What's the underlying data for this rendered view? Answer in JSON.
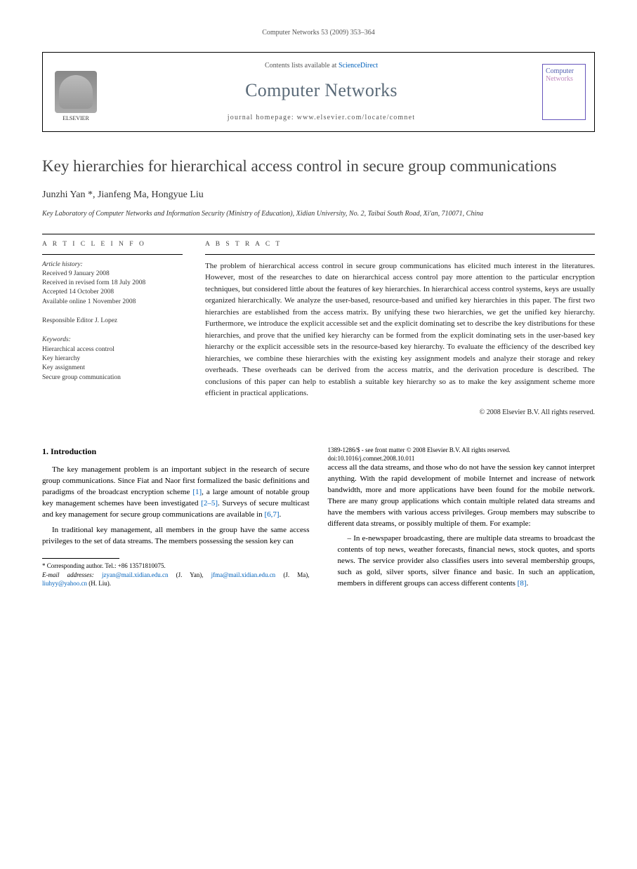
{
  "header": {
    "running": "Computer Networks 53 (2009) 353–364"
  },
  "journal_box": {
    "elsevier": "ELSEVIER",
    "contents_prefix": "Contents lists available at ",
    "contents_link": "ScienceDirect",
    "journal_name": "Computer Networks",
    "homepage_label": "journal homepage: www.elsevier.com/locate/comnet",
    "cover_line1": "Computer",
    "cover_line2": "Networks"
  },
  "article": {
    "title": "Key hierarchies for hierarchical access control in secure group communications",
    "authors": "Junzhi Yan *, Jianfeng Ma, Hongyue Liu",
    "affiliation": "Key Laboratory of Computer Networks and Information Security (Ministry of Education), Xidian University, No. 2, Taibai South Road, Xi'an, 710071, China"
  },
  "article_info": {
    "heading": "A R T I C L E   I N F O",
    "history_label": "Article history:",
    "received": "Received 9 January 2008",
    "revised": "Received in revised form 18 July 2008",
    "accepted": "Accepted 14 October 2008",
    "online": "Available online 1 November 2008",
    "editor": "Responsible Editor J. Lopez",
    "keywords_label": "Keywords:",
    "kw1": "Hierarchical access control",
    "kw2": "Key hierarchy",
    "kw3": "Key assignment",
    "kw4": "Secure group communication"
  },
  "abstract": {
    "heading": "A B S T R A C T",
    "text": "The problem of hierarchical access control in secure group communications has elicited much interest in the literatures. However, most of the researches to date on hierarchical access control pay more attention to the particular encryption techniques, but considered little about the features of key hierarchies. In hierarchical access control systems, keys are usually organized hierarchically. We analyze the user-based, resource-based and unified key hierarchies in this paper. The first two hierarchies are established from the access matrix. By unifying these two hierarchies, we get the unified key hierarchy. Furthermore, we introduce the explicit accessible set and the explicit dominating set to describe the key distributions for these hierarchies, and prove that the unified key hierarchy can be formed from the explicit dominating sets in the user-based key hierarchy or the explicit accessible sets in the resource-based key hierarchy. To evaluate the efficiency of the described key hierarchies, we combine these hierarchies with the existing key assignment models and analyze their storage and rekey overheads. These overheads can be derived from the access matrix, and the derivation procedure is described. The conclusions of this paper can help to establish a suitable key hierarchy so as to make the key assignment scheme more efficient in practical applications.",
    "copyright": "© 2008 Elsevier B.V. All rights reserved."
  },
  "body": {
    "section1": "1. Introduction",
    "p1a": "The key management problem is an important subject in the research of secure group communications. Since Fiat and Naor first formalized the basic definitions and paradigms of the broadcast encryption scheme ",
    "ref1": "[1]",
    "p1b": ", a large amount of notable group key management schemes have been investigated ",
    "ref2": "[2–5]",
    "p1c": ". Surveys of secure multicast and key management for secure group communications are available in ",
    "ref3": "[6,7]",
    "p1d": ".",
    "p2": "In traditional key management, all members in the group have the same access privileges to the set of data streams. The members possessing the session key can",
    "p3": "access all the data streams, and those who do not have the session key cannot interpret anything. With the rapid development of mobile Internet and increase of network bandwidth, more and more applications have been found for the mobile network. There are many group applications which contain multiple related data streams and have the members with various access privileges. Group members may subscribe to different data streams, or possibly multiple of them. For example:",
    "bullet1a": "– In e-newspaper broadcasting, there are multiple data streams to broadcast the contents of top news, weather forecasts, financial news, stock quotes, and sports news. The service provider also classifies users into several membership groups, such as gold, silver sports, silver finance and basic. In such an application, members in different groups can access different contents ",
    "ref4": "[8]",
    "bullet1b": "."
  },
  "footnotes": {
    "corr": "* Corresponding author. Tel.: +86 13571810075.",
    "emails_label": "E-mail addresses: ",
    "e1": "jzyan@mail.xidian.edu.cn",
    "e1n": " (J. Yan), ",
    "e2": "jfma@mail.xidian.edu.cn",
    "e2n": " (J. Ma), ",
    "e3": "liuhyy@yahoo.cn",
    "e3n": " (H. Liu)."
  },
  "doi": {
    "line1": "1389-1286/$ - see front matter © 2008 Elsevier B.V. All rights reserved.",
    "line2": "doi:10.1016/j.comnet.2008.10.011"
  }
}
